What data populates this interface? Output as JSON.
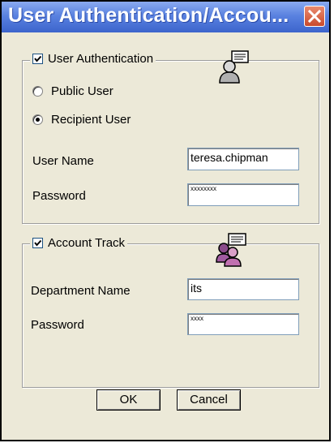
{
  "window": {
    "title": "User Authentication/Accou...",
    "close_icon": "close-icon"
  },
  "user_auth": {
    "checkbox_label": "User Authentication",
    "checked": true,
    "icon": "user-icon",
    "public_user_label": "Public User",
    "recipient_user_label": "Recipient User",
    "selected": "recipient",
    "username_label": "User Name",
    "username_value": "teresa.chipman",
    "password_label": "Password",
    "password_value": "xxxxxxxx"
  },
  "account_track": {
    "checkbox_label": "Account Track",
    "checked": true,
    "icon": "group-users-icon",
    "department_label": "Department Name",
    "department_value": "its",
    "password_label": "Password",
    "password_value": "xxxx"
  },
  "buttons": {
    "ok_label": "OK",
    "cancel_label": "Cancel"
  }
}
